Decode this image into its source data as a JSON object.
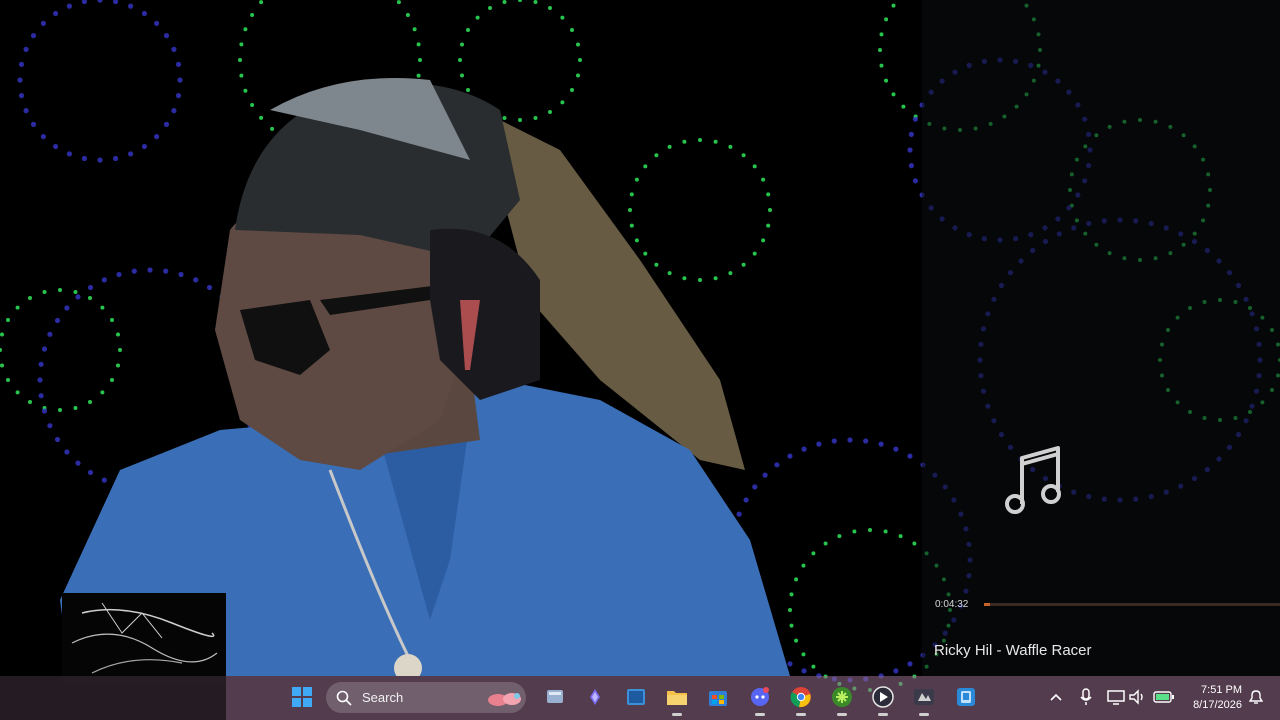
{
  "player": {
    "elapsed": "0:04:32",
    "progress": 0.02,
    "track_title": "Ricky Hil - Waffle Racer"
  },
  "taskbar": {
    "search_placeholder": "Search",
    "pinned": [
      "windows-start",
      "widgets",
      "task-view",
      "copilot",
      "snap",
      "file-explorer",
      "microsoft-store",
      "discord",
      "chrome",
      "app-green",
      "media-player",
      "obs",
      "phone-link"
    ],
    "tray": [
      "chevron-up",
      "microphone",
      "display",
      "volume",
      "battery"
    ],
    "time": "7:51 PM",
    "date": "8/17/2026"
  },
  "colors": {
    "taskbar": "#96708c",
    "progress": "#c8632c",
    "shirt": "#3a6fb8",
    "visualizer_green": "#2ee85a",
    "visualizer_blue": "#3a3ad8"
  }
}
